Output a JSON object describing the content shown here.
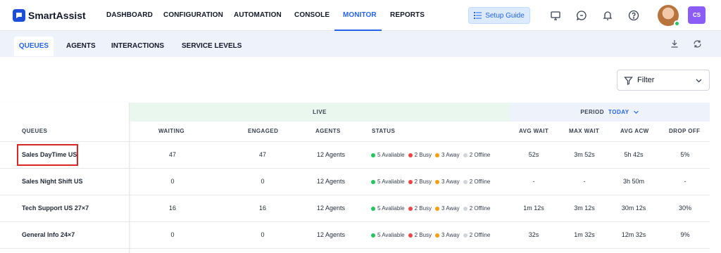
{
  "app": {
    "name": "SmartAssist"
  },
  "nav": {
    "items": [
      {
        "label": "DASHBOARD"
      },
      {
        "label": "CONFIGURATION"
      },
      {
        "label": "AUTOMATION"
      },
      {
        "label": "CONSOLE"
      },
      {
        "label": "MONITOR",
        "active": true
      },
      {
        "label": "REPORTS"
      }
    ],
    "setup_guide": "Setup Guide",
    "user_initials": "CS"
  },
  "subtabs": [
    {
      "label": "QUEUES",
      "active": true
    },
    {
      "label": "AGENTS"
    },
    {
      "label": "INTERACTIONS"
    },
    {
      "label": "SERVICE LEVELS"
    }
  ],
  "filter": {
    "label": "Filter"
  },
  "table": {
    "group_live": "LIVE",
    "group_period": "PERIOD",
    "period_value": "TODAY",
    "headers": {
      "queues": "QUEUES",
      "waiting": "WAITING",
      "engaged": "ENGAGED",
      "agents": "AGENTS",
      "status": "STATUS",
      "avg_wait": "AVG WAIT",
      "max_wait": "MAX WAIT",
      "avg_acw": "AVG ACW",
      "drop_off": "DROP OFF"
    },
    "rows": [
      {
        "queue": "Sales DayTime US",
        "waiting": "47",
        "engaged": "47",
        "agents": "12 Agents",
        "available": "5 Avaliable",
        "busy": "2 Busy",
        "away": "3 Away",
        "offline": "2 Offline",
        "avg_wait": "52s",
        "max_wait": "3m 52s",
        "avg_acw": "5h 42s",
        "drop_off": "5%"
      },
      {
        "queue": "Sales Night Shift US",
        "waiting": "0",
        "engaged": "0",
        "agents": "12 Agents",
        "available": "5 Avaliable",
        "busy": "2 Busy",
        "away": "3 Away",
        "offline": "2 Offline",
        "avg_wait": "-",
        "max_wait": "-",
        "avg_acw": "3h 50m",
        "drop_off": "-"
      },
      {
        "queue": "Tech Support US 27×7",
        "waiting": "16",
        "engaged": "16",
        "agents": "12 Agents",
        "available": "5 Avaliable",
        "busy": "2 Busy",
        "away": "3 Away",
        "offline": "2 Offline",
        "avg_wait": "1m 12s",
        "max_wait": "3m 12s",
        "avg_acw": "30m 12s",
        "drop_off": "30%"
      },
      {
        "queue": "General Info 24×7",
        "waiting": "0",
        "engaged": "0",
        "agents": "12 Agents",
        "available": "5 Avaliable",
        "busy": "2 Busy",
        "away": "3 Away",
        "offline": "2 Offline",
        "avg_wait": "32s",
        "max_wait": "1m 32s",
        "avg_acw": "12m 32s",
        "drop_off": "9%"
      }
    ]
  },
  "colors": {
    "accent": "#2563eb",
    "available": "#22c55e",
    "busy": "#ef4444",
    "away": "#f59e0b",
    "offline": "#d1d5db",
    "highlight": "#dc2626"
  }
}
